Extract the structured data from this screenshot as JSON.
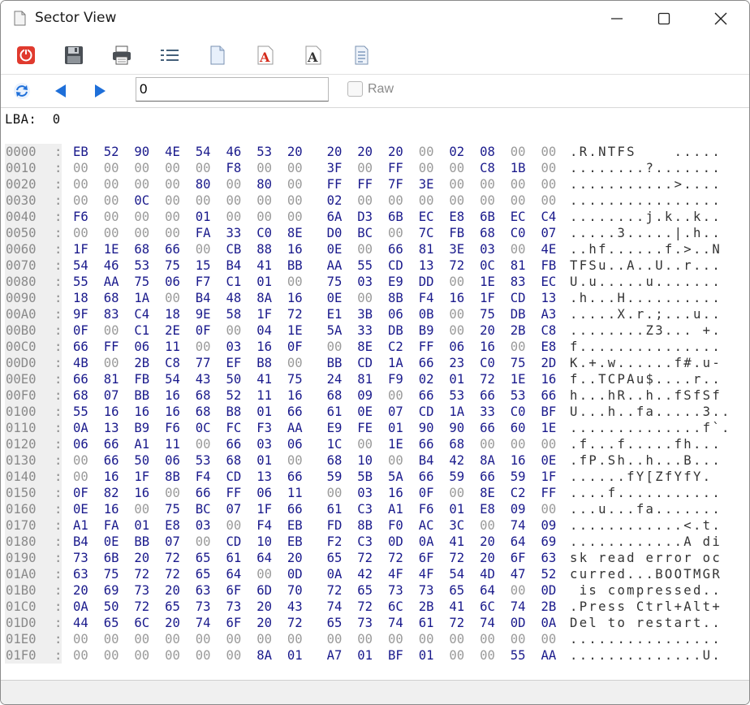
{
  "window": {
    "title": "Sector View"
  },
  "toolbar": {
    "buttons": [
      "close-sector-icon",
      "save-icon",
      "print-icon",
      "list-view-icon",
      "document-icon",
      "font-red-icon",
      "font-black-icon",
      "properties-icon"
    ]
  },
  "nav": {
    "lba_value": "0",
    "raw_label": "Raw",
    "raw_checked": false
  },
  "view": {
    "lba_label": "LBA:",
    "lba_value": "0"
  },
  "hex_rows": [
    {
      "addr": "0000",
      "bytes": [
        "EB",
        "52",
        "90",
        "4E",
        "54",
        "46",
        "53",
        "20",
        "20",
        "20",
        "20",
        "00",
        "02",
        "08",
        "00",
        "00"
      ],
      "ascii": ".R.NTFS    ....."
    },
    {
      "addr": "0010",
      "bytes": [
        "00",
        "00",
        "00",
        "00",
        "00",
        "F8",
        "00",
        "00",
        "3F",
        "00",
        "FF",
        "00",
        "00",
        "C8",
        "1B",
        "00"
      ],
      "ascii": "........?......."
    },
    {
      "addr": "0020",
      "bytes": [
        "00",
        "00",
        "00",
        "00",
        "80",
        "00",
        "80",
        "00",
        "FF",
        "FF",
        "7F",
        "3E",
        "00",
        "00",
        "00",
        "00"
      ],
      "ascii": "...........>...."
    },
    {
      "addr": "0030",
      "bytes": [
        "00",
        "00",
        "0C",
        "00",
        "00",
        "00",
        "00",
        "00",
        "02",
        "00",
        "00",
        "00",
        "00",
        "00",
        "00",
        "00"
      ],
      "ascii": "................"
    },
    {
      "addr": "0040",
      "bytes": [
        "F6",
        "00",
        "00",
        "00",
        "01",
        "00",
        "00",
        "00",
        "6A",
        "D3",
        "6B",
        "EC",
        "E8",
        "6B",
        "EC",
        "C4"
      ],
      "ascii": "........j.k..k.."
    },
    {
      "addr": "0050",
      "bytes": [
        "00",
        "00",
        "00",
        "00",
        "FA",
        "33",
        "C0",
        "8E",
        "D0",
        "BC",
        "00",
        "7C",
        "FB",
        "68",
        "C0",
        "07"
      ],
      "ascii": ".....3.....|.h.."
    },
    {
      "addr": "0060",
      "bytes": [
        "1F",
        "1E",
        "68",
        "66",
        "00",
        "CB",
        "88",
        "16",
        "0E",
        "00",
        "66",
        "81",
        "3E",
        "03",
        "00",
        "4E"
      ],
      "ascii": "..hf......f.>..N"
    },
    {
      "addr": "0070",
      "bytes": [
        "54",
        "46",
        "53",
        "75",
        "15",
        "B4",
        "41",
        "BB",
        "AA",
        "55",
        "CD",
        "13",
        "72",
        "0C",
        "81",
        "FB"
      ],
      "ascii": "TFSu..A..U..r..."
    },
    {
      "addr": "0080",
      "bytes": [
        "55",
        "AA",
        "75",
        "06",
        "F7",
        "C1",
        "01",
        "00",
        "75",
        "03",
        "E9",
        "DD",
        "00",
        "1E",
        "83",
        "EC"
      ],
      "ascii": "U.u.....u......."
    },
    {
      "addr": "0090",
      "bytes": [
        "18",
        "68",
        "1A",
        "00",
        "B4",
        "48",
        "8A",
        "16",
        "0E",
        "00",
        "8B",
        "F4",
        "16",
        "1F",
        "CD",
        "13"
      ],
      "ascii": ".h...H.........."
    },
    {
      "addr": "00A0",
      "bytes": [
        "9F",
        "83",
        "C4",
        "18",
        "9E",
        "58",
        "1F",
        "72",
        "E1",
        "3B",
        "06",
        "0B",
        "00",
        "75",
        "DB",
        "A3"
      ],
      "ascii": ".....X.r.;...u.."
    },
    {
      "addr": "00B0",
      "bytes": [
        "0F",
        "00",
        "C1",
        "2E",
        "0F",
        "00",
        "04",
        "1E",
        "5A",
        "33",
        "DB",
        "B9",
        "00",
        "20",
        "2B",
        "C8"
      ],
      "ascii": "........Z3... +."
    },
    {
      "addr": "00C0",
      "bytes": [
        "66",
        "FF",
        "06",
        "11",
        "00",
        "03",
        "16",
        "0F",
        "00",
        "8E",
        "C2",
        "FF",
        "06",
        "16",
        "00",
        "E8"
      ],
      "ascii": "f..............."
    },
    {
      "addr": "00D0",
      "bytes": [
        "4B",
        "00",
        "2B",
        "C8",
        "77",
        "EF",
        "B8",
        "00",
        "BB",
        "CD",
        "1A",
        "66",
        "23",
        "C0",
        "75",
        "2D"
      ],
      "ascii": "K.+.w......f#.u-"
    },
    {
      "addr": "00E0",
      "bytes": [
        "66",
        "81",
        "FB",
        "54",
        "43",
        "50",
        "41",
        "75",
        "24",
        "81",
        "F9",
        "02",
        "01",
        "72",
        "1E",
        "16"
      ],
      "ascii": "f..TCPAu$....r.."
    },
    {
      "addr": "00F0",
      "bytes": [
        "68",
        "07",
        "BB",
        "16",
        "68",
        "52",
        "11",
        "16",
        "68",
        "09",
        "00",
        "66",
        "53",
        "66",
        "53",
        "66"
      ],
      "ascii": "h...hR..h..fSfSf"
    },
    {
      "addr": "0100",
      "bytes": [
        "55",
        "16",
        "16",
        "16",
        "68",
        "B8",
        "01",
        "66",
        "61",
        "0E",
        "07",
        "CD",
        "1A",
        "33",
        "C0",
        "BF"
      ],
      "ascii": "U...h..fa.....3.."
    },
    {
      "addr": "0110",
      "bytes": [
        "0A",
        "13",
        "B9",
        "F6",
        "0C",
        "FC",
        "F3",
        "AA",
        "E9",
        "FE",
        "01",
        "90",
        "90",
        "66",
        "60",
        "1E"
      ],
      "ascii": "..............f`."
    },
    {
      "addr": "0120",
      "bytes": [
        "06",
        "66",
        "A1",
        "11",
        "00",
        "66",
        "03",
        "06",
        "1C",
        "00",
        "1E",
        "66",
        "68",
        "00",
        "00",
        "00"
      ],
      "ascii": ".f...f.....fh..."
    },
    {
      "addr": "0130",
      "bytes": [
        "00",
        "66",
        "50",
        "06",
        "53",
        "68",
        "01",
        "00",
        "68",
        "10",
        "00",
        "B4",
        "42",
        "8A",
        "16",
        "0E"
      ],
      "ascii": ".fP.Sh..h...B..."
    },
    {
      "addr": "0140",
      "bytes": [
        "00",
        "16",
        "1F",
        "8B",
        "F4",
        "CD",
        "13",
        "66",
        "59",
        "5B",
        "5A",
        "66",
        "59",
        "66",
        "59",
        "1F"
      ],
      "ascii": "......fY[ZfYfY."
    },
    {
      "addr": "0150",
      "bytes": [
        "0F",
        "82",
        "16",
        "00",
        "66",
        "FF",
        "06",
        "11",
        "00",
        "03",
        "16",
        "0F",
        "00",
        "8E",
        "C2",
        "FF"
      ],
      "ascii": "....f..........."
    },
    {
      "addr": "0160",
      "bytes": [
        "0E",
        "16",
        "00",
        "75",
        "BC",
        "07",
        "1F",
        "66",
        "61",
        "C3",
        "A1",
        "F6",
        "01",
        "E8",
        "09",
        "00"
      ],
      "ascii": "...u...fa......."
    },
    {
      "addr": "0170",
      "bytes": [
        "A1",
        "FA",
        "01",
        "E8",
        "03",
        "00",
        "F4",
        "EB",
        "FD",
        "8B",
        "F0",
        "AC",
        "3C",
        "00",
        "74",
        "09"
      ],
      "ascii": "............<.t."
    },
    {
      "addr": "0180",
      "bytes": [
        "B4",
        "0E",
        "BB",
        "07",
        "00",
        "CD",
        "10",
        "EB",
        "F2",
        "C3",
        "0D",
        "0A",
        "41",
        "20",
        "64",
        "69"
      ],
      "ascii": "............A di"
    },
    {
      "addr": "0190",
      "bytes": [
        "73",
        "6B",
        "20",
        "72",
        "65",
        "61",
        "64",
        "20",
        "65",
        "72",
        "72",
        "6F",
        "72",
        "20",
        "6F",
        "63"
      ],
      "ascii": "sk read error oc"
    },
    {
      "addr": "01A0",
      "bytes": [
        "63",
        "75",
        "72",
        "72",
        "65",
        "64",
        "00",
        "0D",
        "0A",
        "42",
        "4F",
        "4F",
        "54",
        "4D",
        "47",
        "52"
      ],
      "ascii": "curred...BOOTMGR"
    },
    {
      "addr": "01B0",
      "bytes": [
        "20",
        "69",
        "73",
        "20",
        "63",
        "6F",
        "6D",
        "70",
        "72",
        "65",
        "73",
        "73",
        "65",
        "64",
        "00",
        "0D"
      ],
      "ascii": " is compressed.."
    },
    {
      "addr": "01C0",
      "bytes": [
        "0A",
        "50",
        "72",
        "65",
        "73",
        "73",
        "20",
        "43",
        "74",
        "72",
        "6C",
        "2B",
        "41",
        "6C",
        "74",
        "2B"
      ],
      "ascii": ".Press Ctrl+Alt+"
    },
    {
      "addr": "01D0",
      "bytes": [
        "44",
        "65",
        "6C",
        "20",
        "74",
        "6F",
        "20",
        "72",
        "65",
        "73",
        "74",
        "61",
        "72",
        "74",
        "0D",
        "0A"
      ],
      "ascii": "Del to restart.."
    },
    {
      "addr": "01E0",
      "bytes": [
        "00",
        "00",
        "00",
        "00",
        "00",
        "00",
        "00",
        "00",
        "00",
        "00",
        "00",
        "00",
        "00",
        "00",
        "00",
        "00"
      ],
      "ascii": "................"
    },
    {
      "addr": "01F0",
      "bytes": [
        "00",
        "00",
        "00",
        "00",
        "00",
        "00",
        "8A",
        "01",
        "A7",
        "01",
        "BF",
        "01",
        "00",
        "00",
        "55",
        "AA"
      ],
      "ascii": "..............U."
    }
  ],
  "colors": {
    "nonzero_byte": "#1a1a8c",
    "zero_byte": "#9a9a9a",
    "address": "#8a8a8a",
    "accent": "#1e6fd9"
  }
}
